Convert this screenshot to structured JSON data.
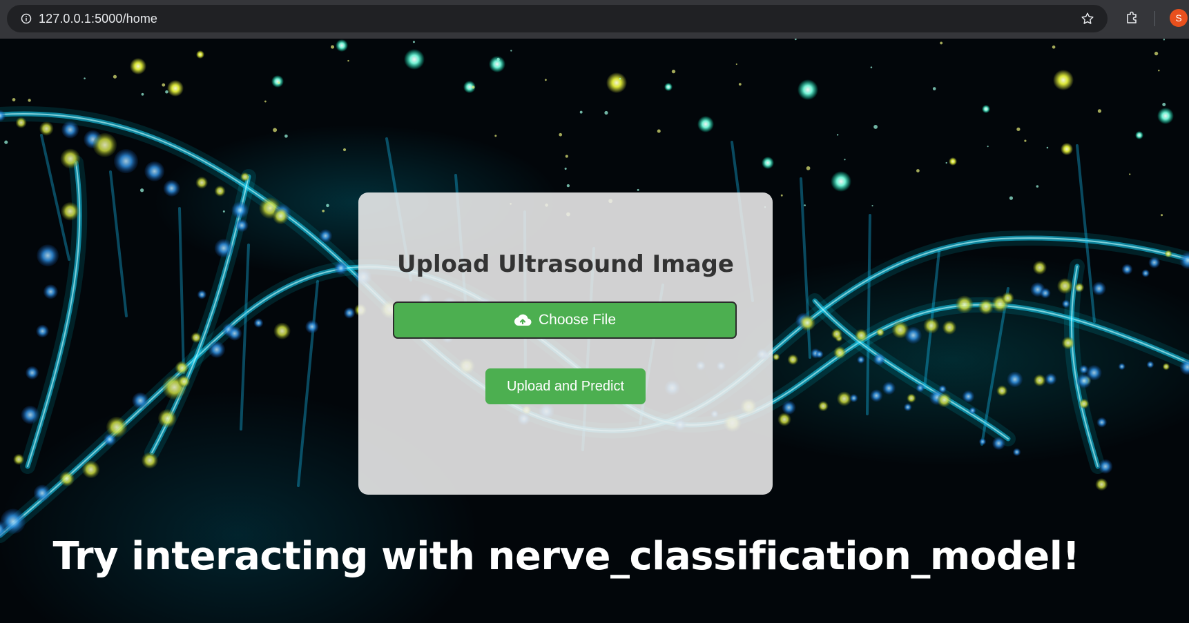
{
  "browser": {
    "url": "127.0.0.1:5000/home",
    "profile_initial": "S",
    "profile_color": "#e8501d"
  },
  "upload_card": {
    "title": "Upload Ultrasound Image",
    "choose_file_label": "Choose File",
    "submit_label": "Upload and Predict",
    "button_color": "#4caf50"
  },
  "promo": {
    "heading": "Try interacting with nerve_classification_model!"
  },
  "icons": {
    "site_info": "info-icon",
    "bookmark": "star-icon",
    "extensions": "puzzle-icon",
    "upload": "cloud-upload-icon"
  }
}
